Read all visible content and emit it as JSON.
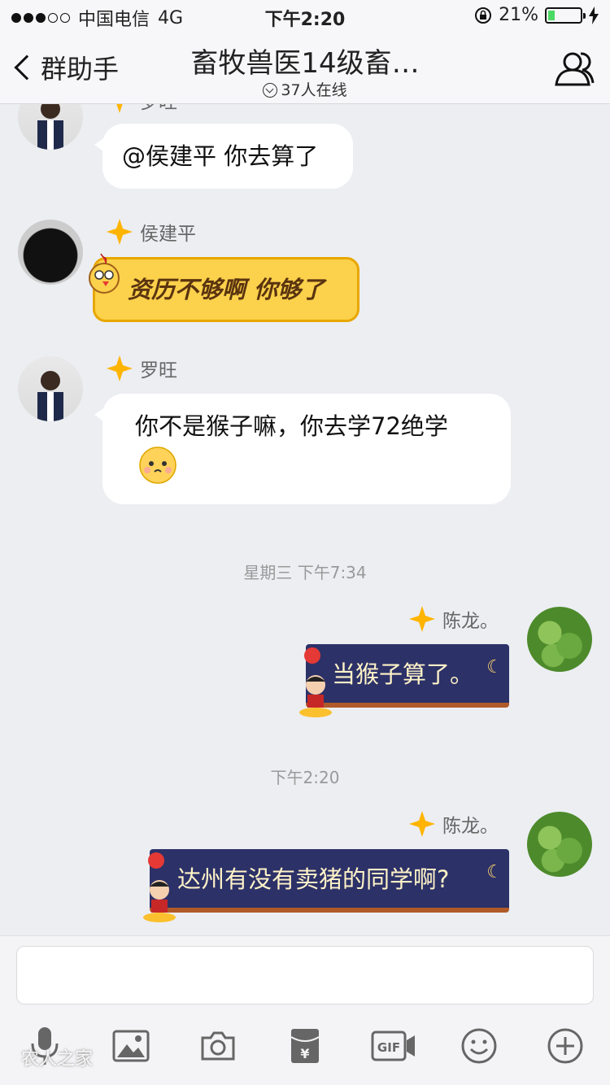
{
  "status_bar": {
    "carrier": "中国电信",
    "network": "4G",
    "time": "下午2:20",
    "battery": "21%",
    "battery_level": 0.21
  },
  "nav": {
    "back_label": "群助手",
    "title": "畜牧兽医14级畜…",
    "online": "37人在线"
  },
  "messages": [
    {
      "sender": "罗旺",
      "text": "@侯建平 你去算了"
    },
    {
      "sender": "侯建平",
      "text": "资历不够啊 你够了"
    },
    {
      "sender": "罗旺",
      "text": "你不是猴子嘛，你去学72绝学"
    },
    {
      "sender": "陈龙。",
      "text": "当猴子算了。"
    },
    {
      "sender": "陈龙。",
      "text": "达州有没有卖猪的同学啊?"
    }
  ],
  "timestamps": [
    "星期三 下午7:34",
    "下午2:20"
  ],
  "input": {
    "placeholder": ""
  },
  "toolbar": [
    "voice-icon",
    "image-icon",
    "camera-icon",
    "red-packet-icon",
    "gif-icon",
    "emoji-icon",
    "plus-icon"
  ],
  "watermark": "农人之家",
  "colors": {
    "accent": "#e8a700",
    "navy_bubble": "#2c3168",
    "battery": "#4cd964"
  }
}
